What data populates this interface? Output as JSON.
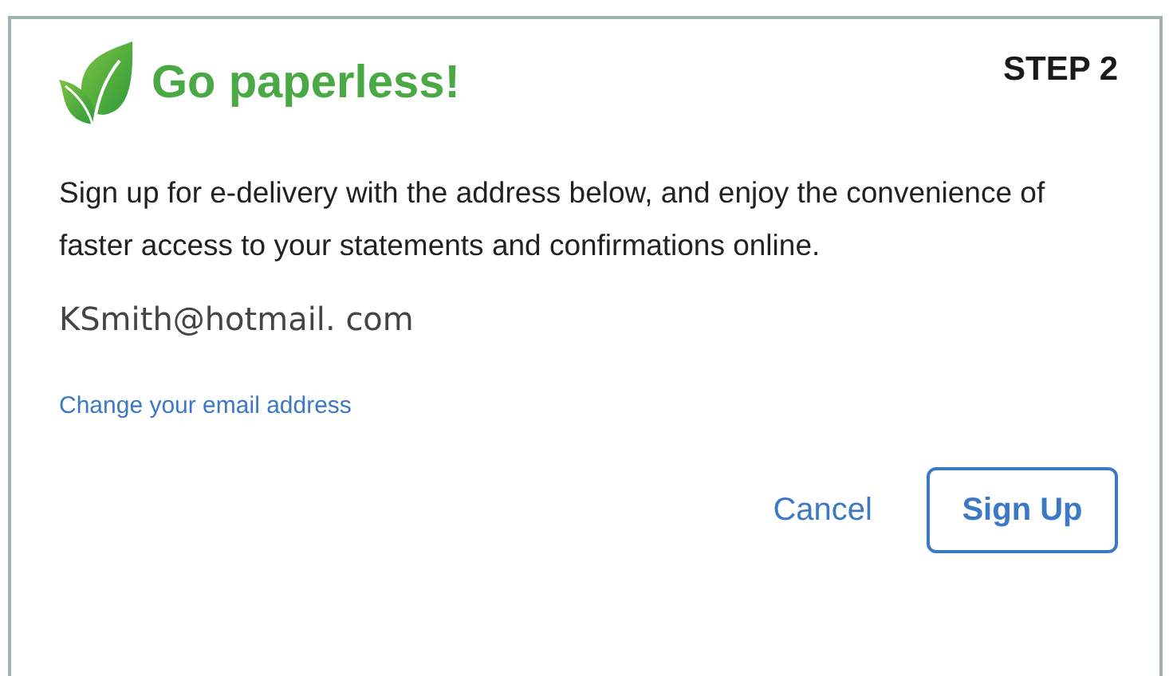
{
  "dialog": {
    "title": "Go paperless!",
    "step_label": "STEP 2",
    "message": "Sign up for e-delivery with the address below, and enjoy the convenience of faster access to your statements and confirmations online.",
    "email": "KSmith@hotmail. com",
    "change_link": "Change your email address",
    "buttons": [
      {
        "label": "Cancel",
        "kind": "text"
      },
      {
        "label": "Sign Up",
        "kind": "outlined"
      }
    ]
  }
}
